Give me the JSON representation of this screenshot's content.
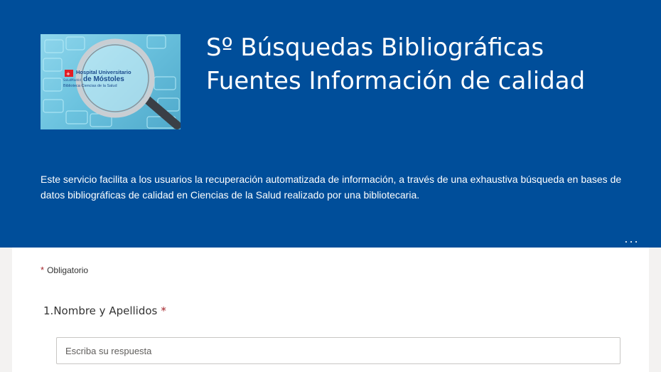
{
  "header": {
    "title_line1": "Sº Búsquedas Bibliográficas",
    "title_line2": "Fuentes Información de calidad",
    "description": "Este servicio facilita a los usuarios la recuperación automatizada de información, a través de una exhaustiva búsqueda en bases de datos bibliográficas de calidad en Ciencias de la Salud realizado por una bibliotecaria.",
    "more_label": "...",
    "logo": {
      "line1": "Hospital Universitario",
      "line2": "de Móstoles",
      "line3": "Biblioteca Ciencias de la Salud",
      "brand_small": "SaludMadrid"
    },
    "background_color": "#004e9a"
  },
  "form": {
    "required_star": "*",
    "required_note": "Obligatorio",
    "questions": [
      {
        "number": "1.",
        "label": "Nombre y Apellidos",
        "required_star": "*",
        "placeholder": "Escriba su respuesta",
        "value": ""
      }
    ]
  }
}
